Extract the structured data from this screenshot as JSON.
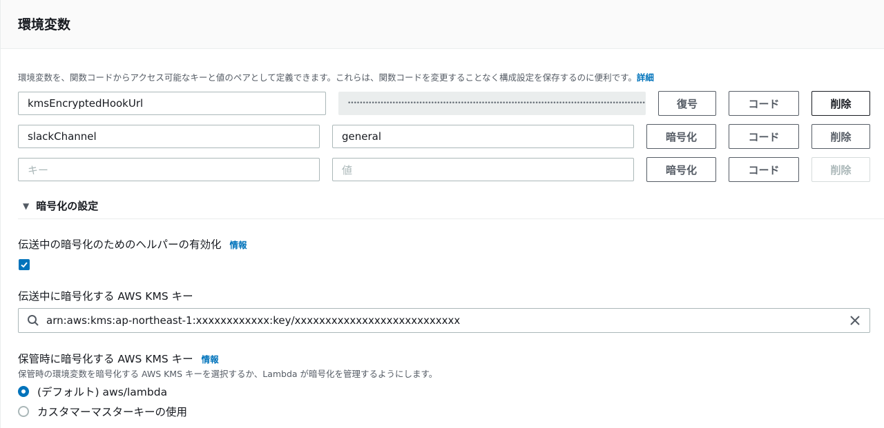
{
  "header": {
    "title": "環境変数"
  },
  "description": {
    "text": "環境変数を、関数コードからアクセス可能なキーと値のペアとして定義できます。これらは、関数コードを変更することなく構成設定を保存するのに便利です。",
    "link": "詳細"
  },
  "env_rows": [
    {
      "key": "kmsEncryptedHookUrl",
      "value_masked": "•••••••••••••••••••••••••••••••••••••••••••••••••••••••••••••••••••••••••••••••••••••••••••••••••••••••••••••••••••••",
      "action": "復号",
      "code": "コード",
      "delete": "削除"
    },
    {
      "key": "slackChannel",
      "value": "general",
      "action": "暗号化",
      "code": "コード",
      "delete": "削除"
    },
    {
      "key_placeholder": "キー",
      "value_placeholder": "値",
      "action": "暗号化",
      "code": "コード",
      "delete": "削除"
    }
  ],
  "encryption": {
    "section_title": "暗号化の設定",
    "transit_helper_label": "伝送中の暗号化のためのヘルパーの有効化",
    "transit_helper_info": "情報",
    "transit_helper_checked": true,
    "transit_key_label": "伝送中に暗号化する AWS KMS キー",
    "transit_key_value": "arn:aws:kms:ap-northeast-1:xxxxxxxxxxxx:key/xxxxxxxxxxxxxxxxxxxxxxxxxxx",
    "rest_key_label": "保管時に暗号化する AWS KMS キー",
    "rest_key_info": "情報",
    "rest_key_desc": "保管時の環境変数を暗号化する AWS KMS キーを選択するか、Lambda が暗号化を管理するようにします。",
    "rest_options": [
      {
        "label": "(デフォルト) aws/lambda",
        "checked": true
      },
      {
        "label": "カスタマーマスターキーの使用",
        "checked": false
      }
    ]
  },
  "colors": {
    "accent": "#0073bb",
    "border": "#aab7b8",
    "text": "#16191f",
    "muted": "#545b64"
  }
}
